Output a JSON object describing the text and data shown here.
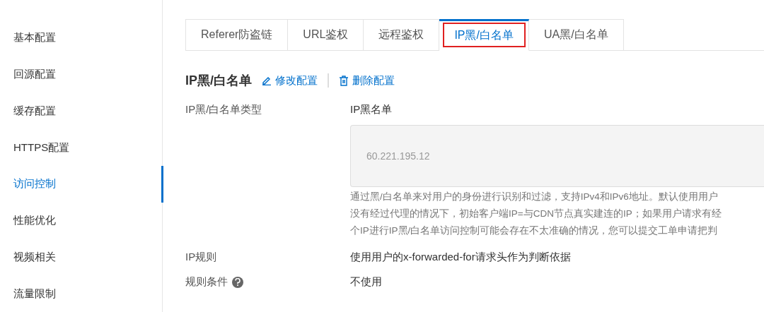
{
  "sidebar": {
    "items": [
      {
        "label": "基本配置",
        "selected": false
      },
      {
        "label": "回源配置",
        "selected": false
      },
      {
        "label": "缓存配置",
        "selected": false
      },
      {
        "label": "HTTPS配置",
        "selected": false
      },
      {
        "label": "访问控制",
        "selected": true
      },
      {
        "label": "性能优化",
        "selected": false
      },
      {
        "label": "视频相关",
        "selected": false
      },
      {
        "label": "流量限制",
        "selected": false
      }
    ]
  },
  "tabs": [
    {
      "label": "Referer防盗链",
      "selected": false,
      "highlighted": false
    },
    {
      "label": "URL鉴权",
      "selected": false,
      "highlighted": false
    },
    {
      "label": "远程鉴权",
      "selected": false,
      "highlighted": false
    },
    {
      "label": "IP黑/白名单",
      "selected": true,
      "highlighted": true
    },
    {
      "label": "UA黑/白名单",
      "selected": false,
      "highlighted": false
    }
  ],
  "section": {
    "title": "IP黑/白名单",
    "actions": [
      {
        "kind": "edit",
        "label": "修改配置"
      },
      {
        "kind": "delete",
        "label": "删除配置"
      }
    ]
  },
  "fields": [
    {
      "label": "IP黑/白名单类型",
      "value": "IP黑名单",
      "textarea": "60.221.195.12",
      "description": [
        "通过黑/白名单来对用户的身份进行识别和过滤，支持IPv4和IPv6地址。默认使用用户",
        "没有经过代理的情况下，初始客户端IP=与CDN节点真实建连的IP；如果用户请求有经",
        "个IP进行IP黑/白名单访问控制可能会存在不太准确的情况，您可以提交工单申请把判"
      ]
    },
    {
      "label": "IP规则",
      "value": "使用用户的x-forwarded-for请求头作为判断依据"
    },
    {
      "label": "规则条件",
      "help": true,
      "value": "不使用"
    }
  ]
}
